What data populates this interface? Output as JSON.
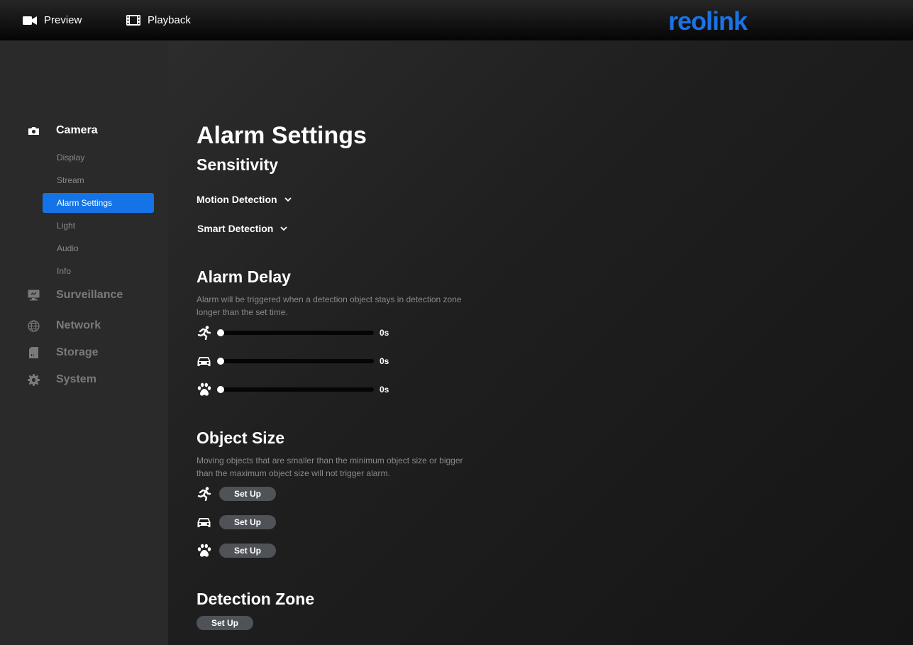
{
  "topbar": {
    "preview_label": "Preview",
    "playback_label": "Playback",
    "logo_text": "reolink"
  },
  "sidebar": {
    "sections": [
      {
        "label": "Camera",
        "icon": "camera-icon",
        "active": true
      },
      {
        "label": "Surveillance",
        "icon": "monitor-icon",
        "active": false
      },
      {
        "label": "Network",
        "icon": "globe-icon",
        "active": false
      },
      {
        "label": "Storage",
        "icon": "sd-card-icon",
        "active": false
      },
      {
        "label": "System",
        "icon": "gear-icon",
        "active": false
      }
    ],
    "camera_items": [
      {
        "label": "Display"
      },
      {
        "label": "Stream"
      },
      {
        "label": "Alarm Settings",
        "active": true
      },
      {
        "label": "Light"
      },
      {
        "label": "Audio"
      },
      {
        "label": "Info"
      }
    ]
  },
  "main": {
    "title": "Alarm Settings",
    "sensitivity": {
      "heading": "Sensitivity",
      "motion_label": "Motion Detection",
      "smart_label": "Smart Detection"
    },
    "alarm_delay": {
      "heading": "Alarm Delay",
      "desc_line1": "Alarm will be triggered when a detection object stays in detection zone",
      "desc_line2": "longer than the set time.",
      "rows": [
        {
          "icon": "person-running-icon",
          "value": "0s"
        },
        {
          "icon": "car-icon",
          "value": "0s"
        },
        {
          "icon": "paw-icon",
          "value": "0s"
        }
      ]
    },
    "object_size": {
      "heading": "Object Size",
      "desc_line1": "Moving objects that are smaller than the minimum object size or bigger",
      "desc_line2": "than the maximum object size will not trigger alarm.",
      "button_label": "Set Up"
    },
    "detection_zone": {
      "heading": "Detection Zone",
      "button_label": "Set Up"
    }
  },
  "colors": {
    "accent": "#1473e6",
    "logo": "#1a73e8",
    "button": "#4f5358"
  }
}
